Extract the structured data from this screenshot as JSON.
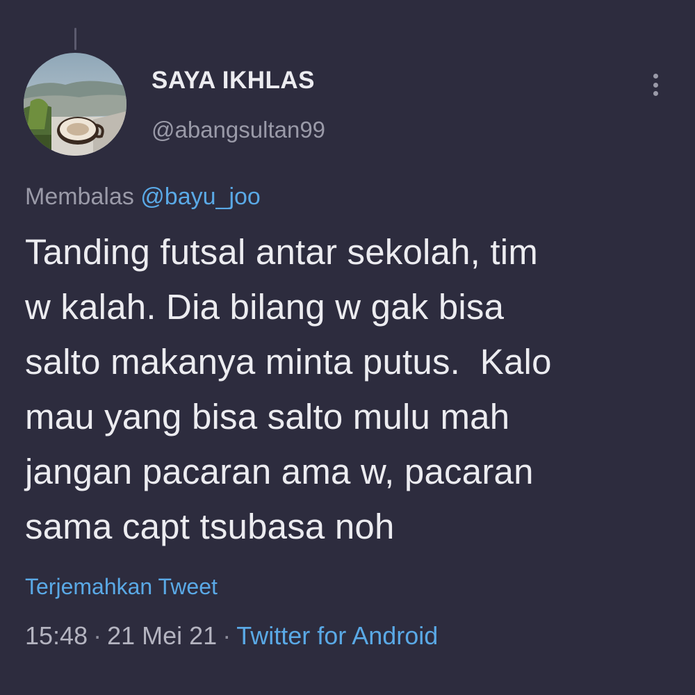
{
  "author": {
    "display_name": "SAYA IKHLAS",
    "handle": "@abangsultan99",
    "avatar_icon": "profile-photo-landscape-coffee-cup"
  },
  "more_icon": "more-vertical-icon",
  "reply": {
    "prefix": "Membalas",
    "to_handle": "@bayu_joo"
  },
  "tweet": {
    "lines": [
      "Tanding futsal antar sekolah, tim",
      "w kalah. Dia bilang w gak bisa",
      "salto makanya minta putus.  Kalo",
      "mau yang bisa salto mulu mah",
      "jangan pacaran ama w, pacaran",
      "sama capt tsubasa noh"
    ]
  },
  "translate_label": "Terjemahkan Tweet",
  "meta": {
    "time": "15:48",
    "separator": "·",
    "date": "21 Mei 21",
    "source": "Twitter for Android"
  },
  "colors": {
    "background": "#2d2c3e",
    "text_primary": "#ececf0",
    "text_secondary": "#9a9aa8",
    "link": "#5aa9e6"
  }
}
